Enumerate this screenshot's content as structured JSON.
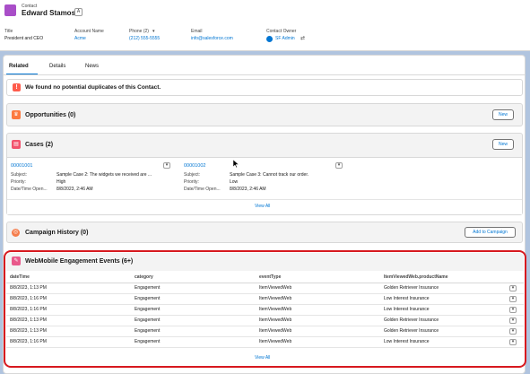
{
  "header": {
    "object_label": "Contact",
    "name": "Edward Stamos",
    "hierarchy_icon": "A",
    "fields": [
      {
        "label": "Title",
        "value": "President and CEO"
      },
      {
        "label": "Account Name",
        "value": "Acme"
      },
      {
        "label": "Phone (2)",
        "value": "(212) 555-5555"
      },
      {
        "label": "Email",
        "value": "info@salesforce.com"
      },
      {
        "label": "Contact Owner",
        "value": "SF Admin"
      }
    ]
  },
  "tabs": [
    "Related",
    "Details",
    "News"
  ],
  "duplicates": {
    "message": "We found no potential duplicates of this Contact."
  },
  "opportunities": {
    "title": "Opportunities (0)",
    "new_label": "New"
  },
  "cases": {
    "title": "Cases (2)",
    "new_label": "New",
    "items": [
      {
        "number": "00001001",
        "subject_label": "Subject:",
        "subject": "Sample Case 2: The widgets we received are ...",
        "priority_label": "Priority:",
        "priority": "High",
        "opened_label": "Date/Time Open...",
        "opened": "8/8/2023, 2:46 AM"
      },
      {
        "number": "00001002",
        "subject_label": "Subject:",
        "subject": "Sample Case 3: Cannot track our order.",
        "priority_label": "Priority:",
        "priority": "Low",
        "opened_label": "Date/Time Open...",
        "opened": "8/8/2023, 2:46 AM"
      }
    ],
    "view_all": "View All"
  },
  "campaign": {
    "title": "Campaign History (0)",
    "button": "Add to Campaign"
  },
  "engagement": {
    "title": "WebMobile Engagement Events (6+)",
    "columns": [
      "dateTime",
      "category",
      "eventType",
      "ItemViewedWeb.productName"
    ],
    "rows": [
      [
        "8/8/2023, 1:13 PM",
        "Engagement",
        "ItemViewedWeb",
        "Golden Retriever Insurance"
      ],
      [
        "8/8/2023, 1:16 PM",
        "Engagement",
        "ItemViewedWeb",
        "Low Interest Insurance"
      ],
      [
        "8/8/2023, 1:16 PM",
        "Engagement",
        "ItemViewedWeb",
        "Low Interest Insurance"
      ],
      [
        "8/8/2023, 1:13 PM",
        "Engagement",
        "ItemViewedWeb",
        "Golden Retriever Insurance"
      ],
      [
        "8/8/2023, 1:13 PM",
        "Engagement",
        "ItemViewedWeb",
        "Golden Retriever Insurance"
      ],
      [
        "8/8/2023, 1:16 PM",
        "Engagement",
        "ItemViewedWeb",
        "Low Interest Insurance"
      ]
    ],
    "view_all": "View All"
  },
  "colors": {
    "brand": "#0176d3",
    "highlight": "#d7191f",
    "contact_icon": "#a94ec8",
    "opportunity_icon": "#fc7a40",
    "case_icon": "#f2536d",
    "campaign_icon": "#f57d4c",
    "engagement_icon": "#e9598b"
  }
}
